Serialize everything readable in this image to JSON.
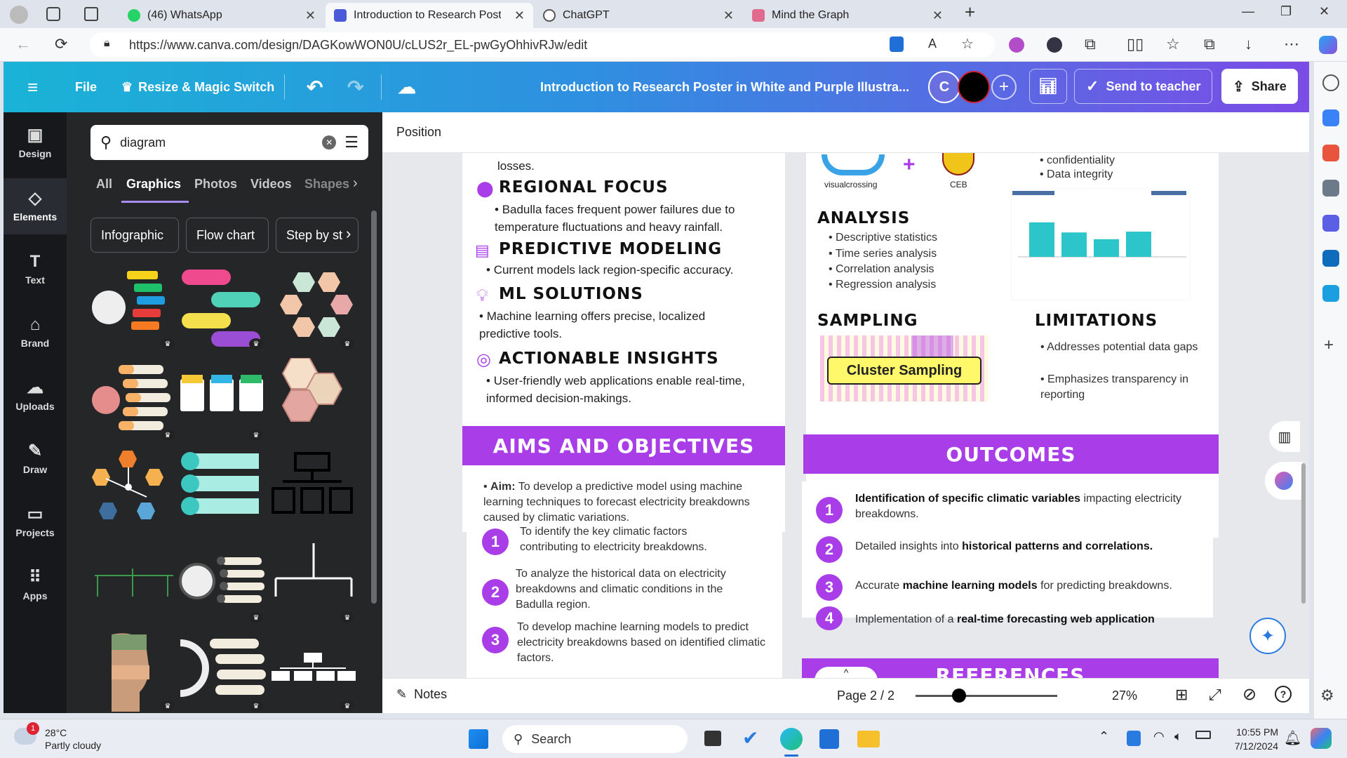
{
  "browser": {
    "tabs": [
      {
        "title": "(46) WhatsApp"
      },
      {
        "title": "Introduction to Research Poster i"
      },
      {
        "title": "ChatGPT"
      },
      {
        "title": "Mind the Graph"
      }
    ],
    "url": "https://www.canva.com/design/DAGKowWON0U/cLUS2r_EL-pwGyOhhivRJw/edit"
  },
  "header": {
    "file": "File",
    "resize": "Resize & Magic Switch",
    "doc_title": "Introduction to Research Poster in White and Purple Illustra...",
    "avatar_letter": "C",
    "send_teacher": "Send to teacher",
    "share": "Share"
  },
  "rail": [
    {
      "label": "Design"
    },
    {
      "label": "Elements"
    },
    {
      "label": "Text"
    },
    {
      "label": "Brand"
    },
    {
      "label": "Uploads"
    },
    {
      "label": "Draw"
    },
    {
      "label": "Projects"
    },
    {
      "label": "Apps"
    }
  ],
  "panel": {
    "search_value": "diagram",
    "tabs": [
      "All",
      "Graphics",
      "Photos",
      "Videos",
      "Shapes"
    ],
    "chips": [
      "Infographic",
      "Flow chart",
      "Step by st"
    ]
  },
  "toolbar": {
    "position": "Position"
  },
  "poster": {
    "top_fragment": "losses.",
    "regional_title": "REGIONAL FOCUS",
    "regional_text": "Badulla faces frequent power failures due to temperature fluctuations and heavy rainfall.",
    "predictive_title": "PREDICTIVE MODELING",
    "predictive_text": "Current models lack region-specific accuracy.",
    "ml_title": "ML SOLUTIONS",
    "ml_text": "Machine learning offers precise, localized predictive tools.",
    "insights_title": "ACTIONABLE INSIGHTS",
    "insights_text": "User-friendly web applications enable real-time, informed decision-makings.",
    "logo_left": "visualcrossing",
    "logo_right": "CEB",
    "top_bullets": [
      "confidentiality",
      "Data integrity"
    ],
    "analysis_title": "ANALYSIS",
    "analysis_items": [
      "Descriptive statistics",
      "Time series analysis",
      "Correlation analysis",
      "Regression analysis"
    ],
    "sampling_title": "SAMPLING",
    "cluster_label": "Cluster Sampling",
    "limitations_title": "LIMITATIONS",
    "limitations_items": [
      "Addresses potential data gaps",
      "Emphasizes transparency in reporting"
    ],
    "aims_header": "AIMS AND OBJECTIVES",
    "aim_label": "Aim:",
    "aim_text": "To develop a predictive model using machine learning techniques to forecast electricity breakdowns caused by climatic variations.",
    "objectives": [
      {
        "n": "1",
        "text": "To identify the key climatic factors contributing to electricity breakdowns."
      },
      {
        "n": "2",
        "text": "To analyze the historical data on electricity breakdowns and climatic conditions in the Badulla region."
      },
      {
        "n": "3",
        "text": "To develop machine learning models to predict electricity breakdowns based on identified climatic factors."
      }
    ],
    "outcomes_header": "OUTCOMES",
    "outcomes": [
      {
        "n": "1",
        "bold": "Identification of specific climatic variables",
        "rest": " impacting electricity breakdowns."
      },
      {
        "n": "2",
        "pre": "Detailed insights into ",
        "bold": "historical patterns and correlations."
      },
      {
        "n": "3",
        "pre": "Accurate ",
        "bold": "machine learning models",
        "rest": " for predicting breakdowns."
      },
      {
        "n": "4",
        "pre": "Implementation of a ",
        "bold": "real-time forecasting web application"
      }
    ],
    "references_header": "REFERENCES",
    "chart": {
      "bars": [
        0.82,
        0.58,
        0.42,
        0.6
      ]
    }
  },
  "bottom": {
    "notes": "Notes",
    "page": "Page 2 / 2",
    "zoom_value": 27,
    "zoom": "27%"
  },
  "taskbar": {
    "temp": "28°C",
    "weather": "Partly cloudy",
    "weather_badge": "1",
    "search": "Search",
    "time": "10:55 PM",
    "date": "7/12/2024"
  },
  "colors": {
    "accent": "#a93ee8",
    "chart_bar": "#2cc5c9",
    "header_start": "#1ab3d6",
    "header_end": "#7b4ce6"
  }
}
